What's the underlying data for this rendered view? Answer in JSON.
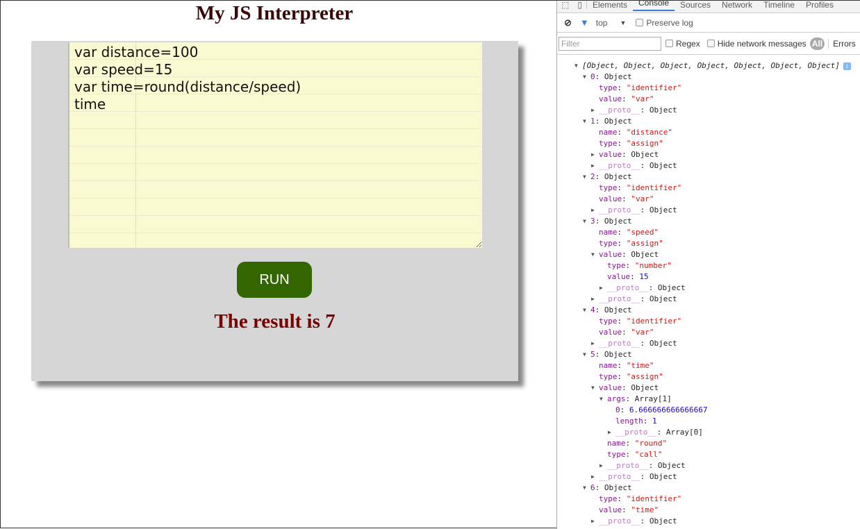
{
  "page": {
    "title": "My JS Interpreter",
    "code": "var distance=100\nvar speed=15\nvar time=round(distance/speed)\ntime",
    "run_label": "RUN",
    "result": "The result is 7"
  },
  "devtools": {
    "tabs": [
      "Elements",
      "Console",
      "Sources",
      "Network",
      "Timeline",
      "Profiles"
    ],
    "active_tab": "Console",
    "context": "top",
    "preserve_log": "Preserve log",
    "filter_placeholder": "Filter",
    "regex": "Regex",
    "hide_network": "Hide network messages",
    "all": "All",
    "errors": "Errors",
    "colors": {
      "accent": "#3879d9",
      "string": "#c41a16",
      "number": "#1c00cf",
      "key": "#881391"
    },
    "rows": [
      {
        "depth": 0,
        "arrow": "expanded",
        "key": "",
        "value": "[Object, Object, Object, Object, Object, Object, Object]",
        "kind": "summary"
      },
      {
        "depth": 1,
        "arrow": "expanded",
        "key": "0",
        "value": "Object",
        "kind": "obj"
      },
      {
        "depth": 2,
        "arrow": "none",
        "key": "type",
        "value": "\"identifier\"",
        "kind": "string"
      },
      {
        "depth": 2,
        "arrow": "none",
        "key": "value",
        "value": "\"var\"",
        "kind": "string"
      },
      {
        "depth": 2,
        "arrow": "collapsed",
        "key": "__proto__",
        "value": "Object",
        "kind": "proto"
      },
      {
        "depth": 1,
        "arrow": "expanded",
        "key": "1",
        "value": "Object",
        "kind": "obj"
      },
      {
        "depth": 2,
        "arrow": "none",
        "key": "name",
        "value": "\"distance\"",
        "kind": "string"
      },
      {
        "depth": 2,
        "arrow": "none",
        "key": "type",
        "value": "\"assign\"",
        "kind": "string"
      },
      {
        "depth": 2,
        "arrow": "collapsed",
        "key": "value",
        "value": "Object",
        "kind": "obj"
      },
      {
        "depth": 2,
        "arrow": "collapsed",
        "key": "__proto__",
        "value": "Object",
        "kind": "proto"
      },
      {
        "depth": 1,
        "arrow": "expanded",
        "key": "2",
        "value": "Object",
        "kind": "obj"
      },
      {
        "depth": 2,
        "arrow": "none",
        "key": "type",
        "value": "\"identifier\"",
        "kind": "string"
      },
      {
        "depth": 2,
        "arrow": "none",
        "key": "value",
        "value": "\"var\"",
        "kind": "string"
      },
      {
        "depth": 2,
        "arrow": "collapsed",
        "key": "__proto__",
        "value": "Object",
        "kind": "proto"
      },
      {
        "depth": 1,
        "arrow": "expanded",
        "key": "3",
        "value": "Object",
        "kind": "obj"
      },
      {
        "depth": 2,
        "arrow": "none",
        "key": "name",
        "value": "\"speed\"",
        "kind": "string"
      },
      {
        "depth": 2,
        "arrow": "none",
        "key": "type",
        "value": "\"assign\"",
        "kind": "string"
      },
      {
        "depth": 2,
        "arrow": "expanded",
        "key": "value",
        "value": "Object",
        "kind": "obj"
      },
      {
        "depth": 3,
        "arrow": "none",
        "key": "type",
        "value": "\"number\"",
        "kind": "string"
      },
      {
        "depth": 3,
        "arrow": "none",
        "key": "value",
        "value": "15",
        "kind": "number"
      },
      {
        "depth": 3,
        "arrow": "collapsed",
        "key": "__proto__",
        "value": "Object",
        "kind": "proto"
      },
      {
        "depth": 2,
        "arrow": "collapsed",
        "key": "__proto__",
        "value": "Object",
        "kind": "proto"
      },
      {
        "depth": 1,
        "arrow": "expanded",
        "key": "4",
        "value": "Object",
        "kind": "obj"
      },
      {
        "depth": 2,
        "arrow": "none",
        "key": "type",
        "value": "\"identifier\"",
        "kind": "string"
      },
      {
        "depth": 2,
        "arrow": "none",
        "key": "value",
        "value": "\"var\"",
        "kind": "string"
      },
      {
        "depth": 2,
        "arrow": "collapsed",
        "key": "__proto__",
        "value": "Object",
        "kind": "proto"
      },
      {
        "depth": 1,
        "arrow": "expanded",
        "key": "5",
        "value": "Object",
        "kind": "obj"
      },
      {
        "depth": 2,
        "arrow": "none",
        "key": "name",
        "value": "\"time\"",
        "kind": "string"
      },
      {
        "depth": 2,
        "arrow": "none",
        "key": "type",
        "value": "\"assign\"",
        "kind": "string"
      },
      {
        "depth": 2,
        "arrow": "expanded",
        "key": "value",
        "value": "Object",
        "kind": "obj"
      },
      {
        "depth": 3,
        "arrow": "expanded",
        "key": "args",
        "value": "Array[1]",
        "kind": "obj"
      },
      {
        "depth": 4,
        "arrow": "none",
        "key": "0",
        "value": "6.666666666666667",
        "kind": "number"
      },
      {
        "depth": 4,
        "arrow": "none",
        "key": "length",
        "value": "1",
        "kind": "number"
      },
      {
        "depth": 4,
        "arrow": "collapsed",
        "key": "__proto__",
        "value": "Array[0]",
        "kind": "proto"
      },
      {
        "depth": 3,
        "arrow": "none",
        "key": "name",
        "value": "\"round\"",
        "kind": "string"
      },
      {
        "depth": 3,
        "arrow": "none",
        "key": "type",
        "value": "\"call\"",
        "kind": "string"
      },
      {
        "depth": 3,
        "arrow": "collapsed",
        "key": "__proto__",
        "value": "Object",
        "kind": "proto"
      },
      {
        "depth": 2,
        "arrow": "collapsed",
        "key": "__proto__",
        "value": "Object",
        "kind": "proto"
      },
      {
        "depth": 1,
        "arrow": "expanded",
        "key": "6",
        "value": "Object",
        "kind": "obj"
      },
      {
        "depth": 2,
        "arrow": "none",
        "key": "type",
        "value": "\"identifier\"",
        "kind": "string"
      },
      {
        "depth": 2,
        "arrow": "none",
        "key": "value",
        "value": "\"time\"",
        "kind": "string"
      },
      {
        "depth": 2,
        "arrow": "collapsed",
        "key": "__proto__",
        "value": "Object",
        "kind": "proto"
      }
    ]
  }
}
